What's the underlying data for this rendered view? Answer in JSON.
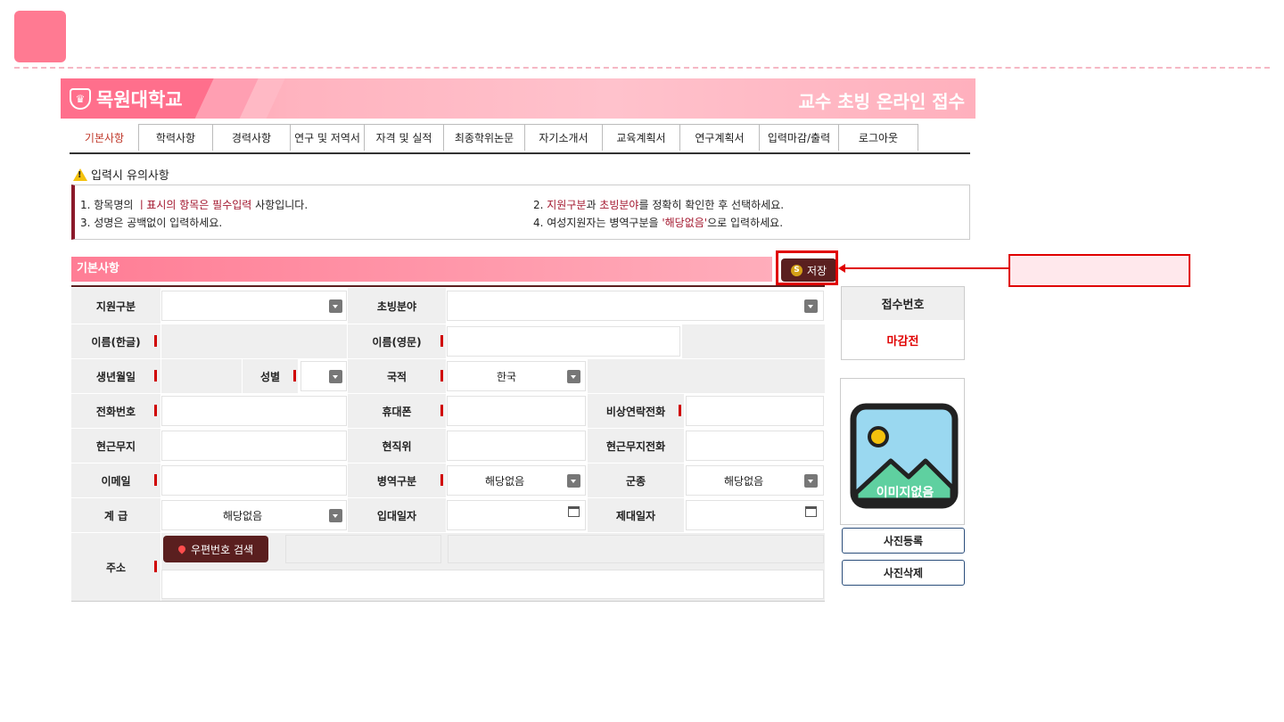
{
  "header": {
    "university": "목원대학교",
    "title": "교수 초빙 온라인 접수"
  },
  "tabs": [
    {
      "label": "기본사항",
      "active": true
    },
    {
      "label": "학력사항"
    },
    {
      "label": "경력사항"
    },
    {
      "label": "연구 및 저역서"
    },
    {
      "label": "자격 및 실적"
    },
    {
      "label": "최종학위논문"
    },
    {
      "label": "자기소개서"
    },
    {
      "label": "교육계획서"
    },
    {
      "label": "연구계획서"
    },
    {
      "label": "입력마감/출력"
    },
    {
      "label": "로그아웃"
    }
  ],
  "notice": {
    "title": "입력시 유의사항",
    "item1_pre": "1. 항목명의 ",
    "item1_red": "ㅣ표시의 항목은 필수입력",
    "item1_post": " 사항입니다.",
    "item2_pre": "2. ",
    "item2_red1": "지원구분",
    "item2_mid": "과 ",
    "item2_red2": "초빙분야",
    "item2_post": "를 정확히 확인한 후 선택하세요.",
    "item3": "3. 성명은 공백없이 입력하세요.",
    "item4_pre": "4. 여성지원자는 병역구분을 ",
    "item4_red": "'해당없음'",
    "item4_post": "으로 입력하세요."
  },
  "section": {
    "title": "기본사항",
    "save_label": "저장",
    "save_icon_glyph": "S"
  },
  "form": {
    "labels": {
      "apply_type": "지원구분",
      "field": "초빙분야",
      "name_kr": "이름(한글)",
      "name_en": "이름(영문)",
      "birth": "생년월일",
      "gender": "성별",
      "nationality": "국적",
      "phone": "전화번호",
      "mobile": "휴대폰",
      "emergency": "비상연락전화",
      "workplace": "현근무지",
      "position": "현직위",
      "work_phone": "현근무지전화",
      "email": "이메일",
      "military": "병역구분",
      "branch": "군종",
      "rank": "계 급",
      "enlist_date": "입대일자",
      "discharge_date": "제대일자",
      "address": "주소"
    },
    "values": {
      "nationality": "한국",
      "military": "해당없음",
      "branch": "해당없음",
      "rank": "해당없음"
    },
    "zip_search_label": "우편번호 검색"
  },
  "side": {
    "receipt_label": "접수번호",
    "receipt_value": "마감전",
    "no_image_text": "이미지없음",
    "photo_register": "사진등록",
    "photo_delete": "사진삭제"
  },
  "colors": {
    "brand_pink": "#ff7a92",
    "brand_dark": "#5a1f1f",
    "highlight_red": "#e00000"
  }
}
